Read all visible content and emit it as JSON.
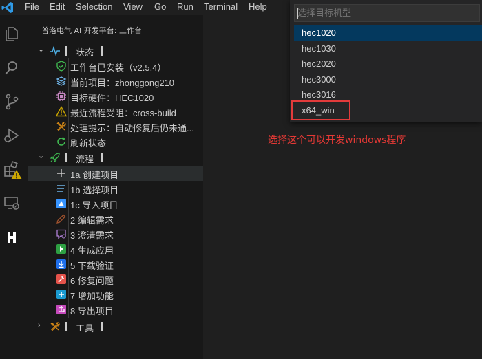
{
  "menubar": {
    "items": [
      "File",
      "Edit",
      "Selection",
      "View",
      "Go",
      "Run",
      "Terminal",
      "Help"
    ]
  },
  "sidebar": {
    "title": "普洛电气 AI 开发平台: 工作台",
    "status_section": {
      "label": "状态",
      "items": [
        {
          "icon": "shield-check-icon",
          "label": "工作台已安装（v2.5.4）"
        },
        {
          "icon": "project-icon",
          "label": "当前项目：zhonggong210"
        },
        {
          "icon": "chip-icon",
          "label": "目标硬件：HEC1020"
        },
        {
          "icon": "warning-icon",
          "label": "最近流程受阻：cross-build"
        },
        {
          "icon": "tools-icon",
          "label": "处理提示：自动修复后仍未通..."
        },
        {
          "icon": "refresh-icon",
          "label": "刷新状态"
        }
      ]
    },
    "flow_section": {
      "label": "流程",
      "items": [
        {
          "icon": "plus-icon",
          "label": "1a 创建项目"
        },
        {
          "icon": "list-icon",
          "label": "1b 选择项目"
        },
        {
          "icon": "import-icon",
          "label": "1c 导入项目"
        },
        {
          "icon": "pencil-icon",
          "label": "2 编辑需求"
        },
        {
          "icon": "comment-icon",
          "label": "3 澄清需求"
        },
        {
          "icon": "play-icon",
          "label": "4 生成应用"
        },
        {
          "icon": "download-icon",
          "label": "5 下载验证"
        },
        {
          "icon": "wrench-icon",
          "label": "6 修复问题"
        },
        {
          "icon": "add-feature-icon",
          "label": "7 增加功能"
        },
        {
          "icon": "export-icon",
          "label": "8 导出项目"
        }
      ]
    },
    "tools_section": {
      "label": "工具"
    }
  },
  "quickpick": {
    "placeholder": "选择目标机型",
    "items": [
      "hec1020",
      "hec1030",
      "hec2020",
      "hec3000",
      "hec3016",
      "x64_win"
    ],
    "active_index": 0,
    "highlighted_item": "x64_win"
  },
  "annotation": {
    "text": "选择这个可以开发windows程序",
    "color": "#e53935"
  },
  "colors": {
    "accent": "#0078d4",
    "active_item": "#04395e",
    "warning": "#cca700"
  }
}
